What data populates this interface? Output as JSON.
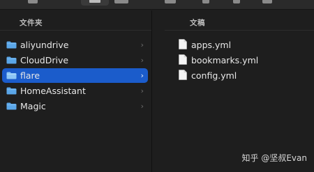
{
  "toolbar": {
    "icons": [
      "grid-icon",
      "list-icon",
      "columns-icon",
      "gallery-icon",
      "tag-icon",
      "more-icon"
    ]
  },
  "left_column": {
    "header": "文件夹",
    "items": [
      {
        "label": "aliyundrive",
        "selected": false
      },
      {
        "label": "CloudDrive",
        "selected": false
      },
      {
        "label": "flare",
        "selected": true
      },
      {
        "label": "HomeAssistant",
        "selected": false
      },
      {
        "label": "Magic",
        "selected": false
      }
    ]
  },
  "right_column": {
    "header": "文稿",
    "items": [
      {
        "label": "apps.yml"
      },
      {
        "label": "bookmarks.yml"
      },
      {
        "label": "config.yml"
      }
    ]
  },
  "watermark": "知乎 @坚叔Evan",
  "colors": {
    "background": "#1e1e1e",
    "selection": "#1b5ccb",
    "folder_blue": "#5aa6e8"
  }
}
